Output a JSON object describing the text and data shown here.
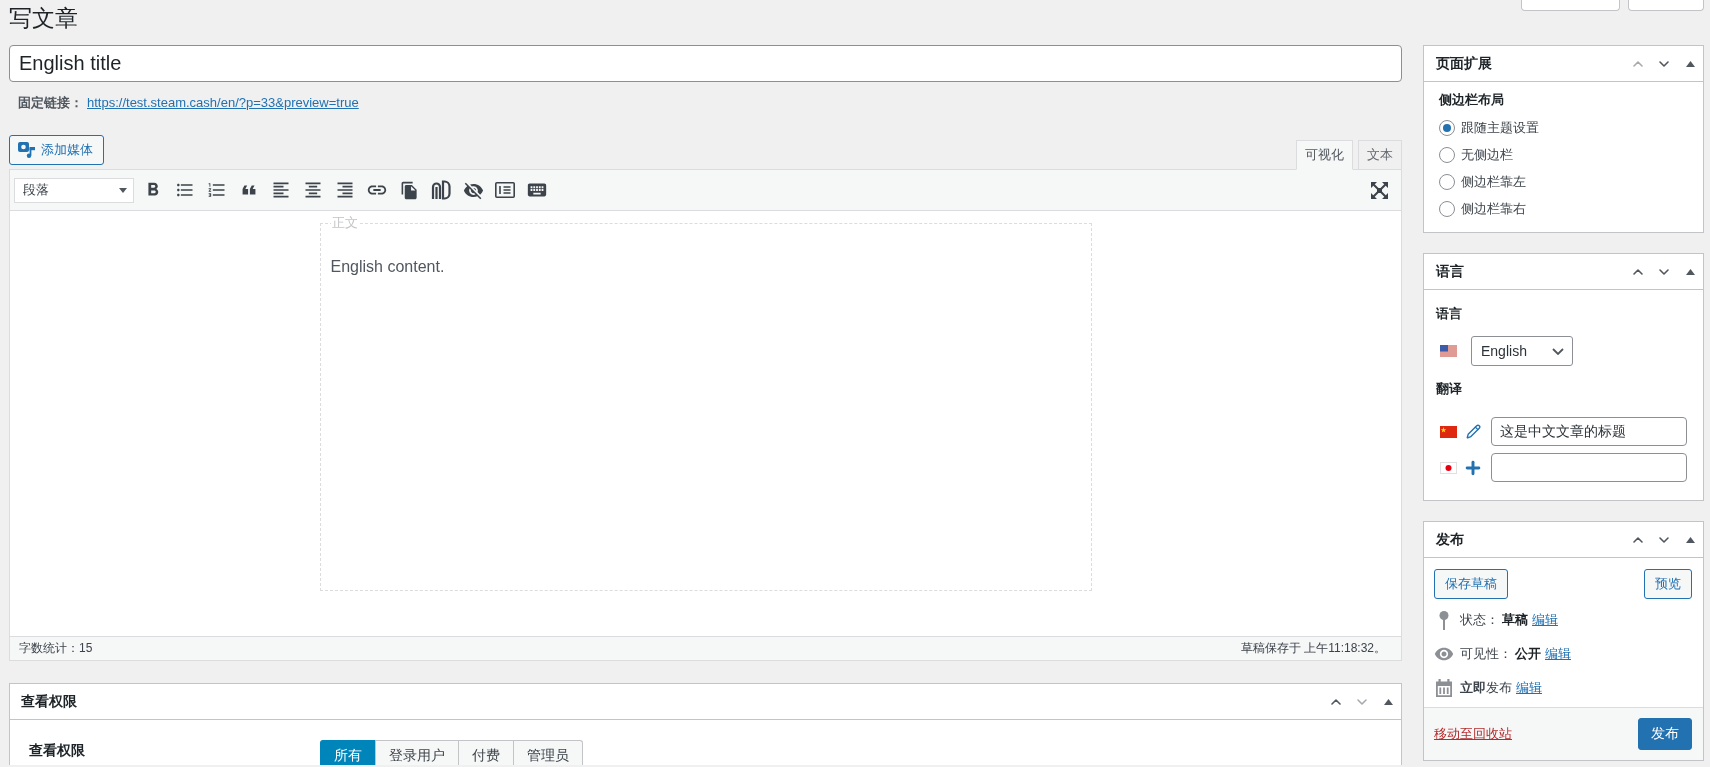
{
  "page": {
    "title": "写文章"
  },
  "post": {
    "title": "English title",
    "permalink_label": "固定链接：",
    "permalink": "https://test.steam.cash/en/?p=33&preview=true"
  },
  "editor": {
    "add_media": "添加媒体",
    "tabs": [
      {
        "label": "可视化",
        "selected": true
      },
      {
        "label": "文本",
        "selected": false
      }
    ],
    "format": "段落",
    "frame_legend": "正文",
    "content": "English content.",
    "word_count": "字数统计：15",
    "saved_status": "草稿保存于 上午11:18:32。"
  },
  "access_panel": {
    "title": "查看权限",
    "expanded": true,
    "can_move_up": true,
    "can_move_down": false,
    "label": "查看权限",
    "options": [
      {
        "label": "所有",
        "selected": true
      },
      {
        "label": "登录用户",
        "selected": false
      },
      {
        "label": "付费",
        "selected": false
      },
      {
        "label": "管理员",
        "selected": false
      }
    ]
  },
  "sidebar": {
    "page_extension": {
      "title": "页面扩展",
      "expanded": true,
      "can_move_up": false,
      "can_move_down": true,
      "group_label": "侧边栏布局",
      "options": [
        {
          "label": "跟随主题设置",
          "selected": true
        },
        {
          "label": "无侧边栏",
          "selected": false
        },
        {
          "label": "侧边栏靠左",
          "selected": false
        },
        {
          "label": "侧边栏靠右",
          "selected": false
        }
      ]
    },
    "language": {
      "title": "语言",
      "expanded": true,
      "can_move_up": true,
      "can_move_down": true,
      "language_label": "语言",
      "language": "English",
      "translations_label": "翻译",
      "translations": [
        {
          "kind": "edit",
          "value": "这是中文文章的标题"
        },
        {
          "kind": "add"
        }
      ]
    },
    "publish": {
      "title": "发布",
      "expanded": true,
      "can_move_up": true,
      "can_move_down": true,
      "save_draft": "保存草稿",
      "preview": "预览",
      "rows": [
        {
          "kind": "status",
          "label": "状态：",
          "value": "草稿",
          "link": "编辑"
        },
        {
          "kind": "visibility",
          "label": "可见性：",
          "value": "公开",
          "link": "编辑"
        },
        {
          "kind": "schedule",
          "text": "**立即**发布",
          "link": "编辑"
        }
      ],
      "trash": "移动至回收站",
      "publish": "发布"
    }
  }
}
